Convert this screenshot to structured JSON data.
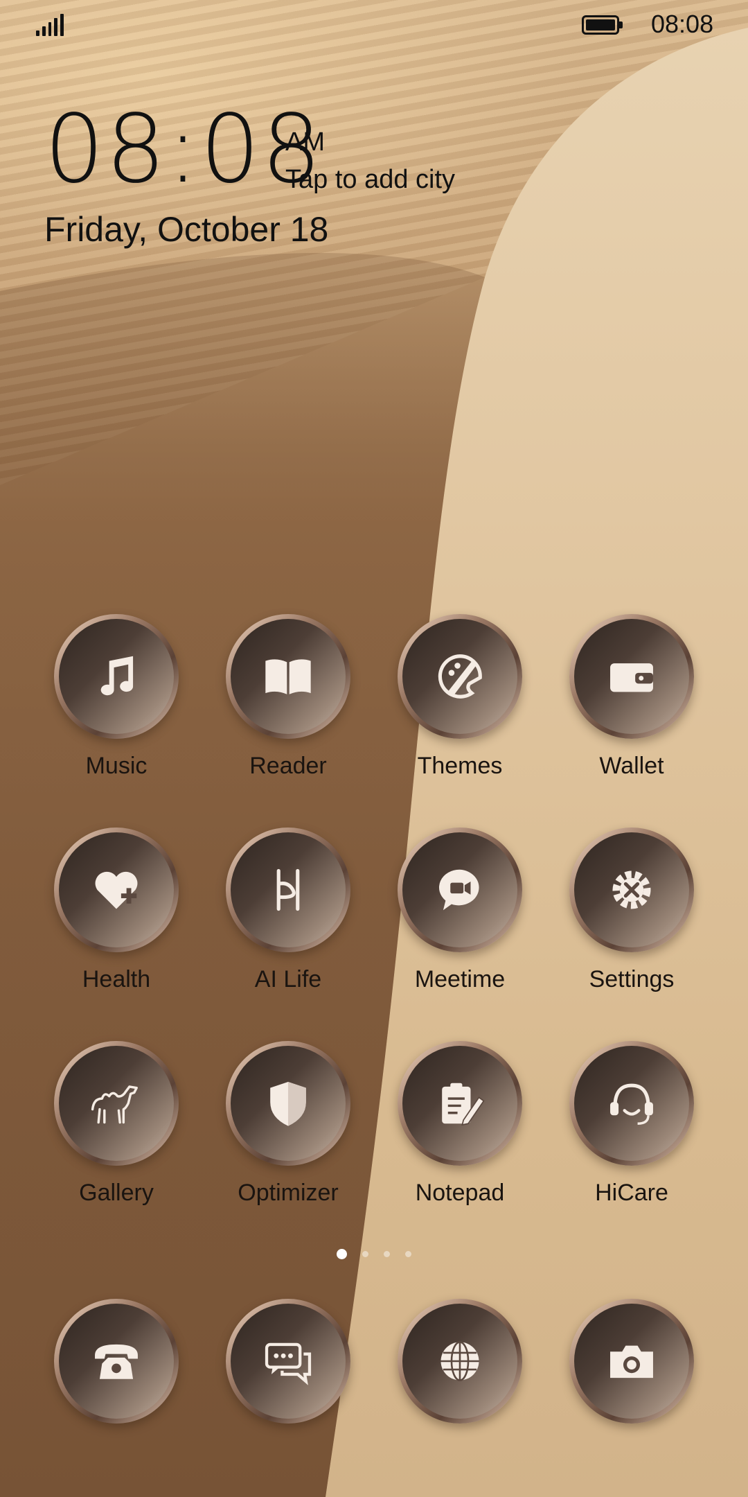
{
  "status_bar": {
    "time": "08:08"
  },
  "clock": {
    "time": "08:08",
    "ampm": "AM",
    "city_prompt": "Tap to add city",
    "date": "Friday, October 18"
  },
  "apps": [
    {
      "label": "Music",
      "icon": "music-note-icon"
    },
    {
      "label": "Reader",
      "icon": "book-icon"
    },
    {
      "label": "Themes",
      "icon": "paintbrush-palette-icon"
    },
    {
      "label": "Wallet",
      "icon": "wallet-icon"
    },
    {
      "label": "Health",
      "icon": "heart-plus-icon"
    },
    {
      "label": "AI Life",
      "icon": "ai-life-icon"
    },
    {
      "label": "Meetime",
      "icon": "video-chat-icon"
    },
    {
      "label": "Settings",
      "icon": "gear-tools-icon"
    },
    {
      "label": "Gallery",
      "icon": "camel-icon"
    },
    {
      "label": "Optimizer",
      "icon": "shield-icon"
    },
    {
      "label": "Notepad",
      "icon": "clipboard-pencil-icon"
    },
    {
      "label": "HiCare",
      "icon": "headset-icon"
    }
  ],
  "dock": [
    {
      "icon": "phone-icon"
    },
    {
      "icon": "messages-icon"
    },
    {
      "icon": "globe-icon"
    },
    {
      "icon": "camera-icon"
    }
  ],
  "page_indicator": {
    "pages": 4,
    "current": 1
  },
  "colors": {
    "icon_glyph": "#f5ece4",
    "label_text": "#1a1410"
  }
}
